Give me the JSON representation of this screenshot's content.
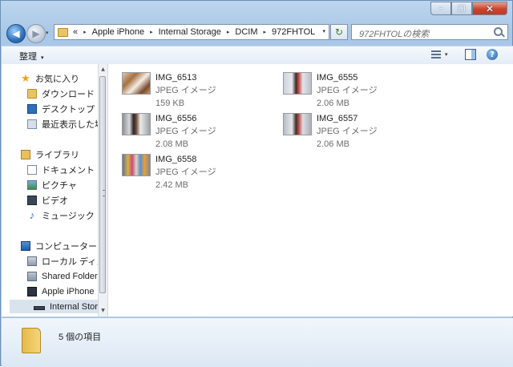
{
  "window": {
    "minimize_label": "–",
    "maximize_label": "□",
    "close_label": "✕"
  },
  "nav": {
    "back_label": "◀",
    "forward_label": "▶",
    "history_dropdown": "▾"
  },
  "address": {
    "overflow": "«",
    "crumbs": [
      "Apple iPhone",
      "Internal Storage",
      "DCIM",
      "972FHTOL"
    ],
    "separator": "▸",
    "dropdown": "▾"
  },
  "refresh_label": "↻",
  "search": {
    "placeholder": "972FHTOLの検索"
  },
  "toolbar": {
    "organize_label": "整理",
    "organize_arrow": "▾",
    "view_arrow": "▾",
    "help_label": "?"
  },
  "sidebar": {
    "favorites": {
      "label": "お気に入り",
      "items": [
        "ダウンロード",
        "デスクトップ",
        "最近表示した場所"
      ]
    },
    "libraries": {
      "label": "ライブラリ",
      "items": [
        "ドキュメント",
        "ピクチャ",
        "ビデオ",
        "ミュージック"
      ]
    },
    "computer": {
      "label": "コンピューター",
      "items": [
        "ローカル ディスク",
        "Shared Folders",
        "Apple iPhone",
        "Internal Storage"
      ]
    },
    "selected": "Internal Storage"
  },
  "files": [
    {
      "name": "IMG_6513",
      "type": "JPEG イメージ",
      "size": "159 KB"
    },
    {
      "name": "IMG_6555",
      "type": "JPEG イメージ",
      "size": "2.06 MB"
    },
    {
      "name": "IMG_6556",
      "type": "JPEG イメージ",
      "size": "2.08 MB"
    },
    {
      "name": "IMG_6557",
      "type": "JPEG イメージ",
      "size": "2.06 MB"
    },
    {
      "name": "IMG_6558",
      "type": "JPEG イメージ",
      "size": "2.42 MB"
    }
  ],
  "details": {
    "item_count": "5 個の項目"
  },
  "colors": {
    "accent": "#2f6fb9",
    "window_frame": "#bcd6ee",
    "selection": "#d9e3ee"
  }
}
